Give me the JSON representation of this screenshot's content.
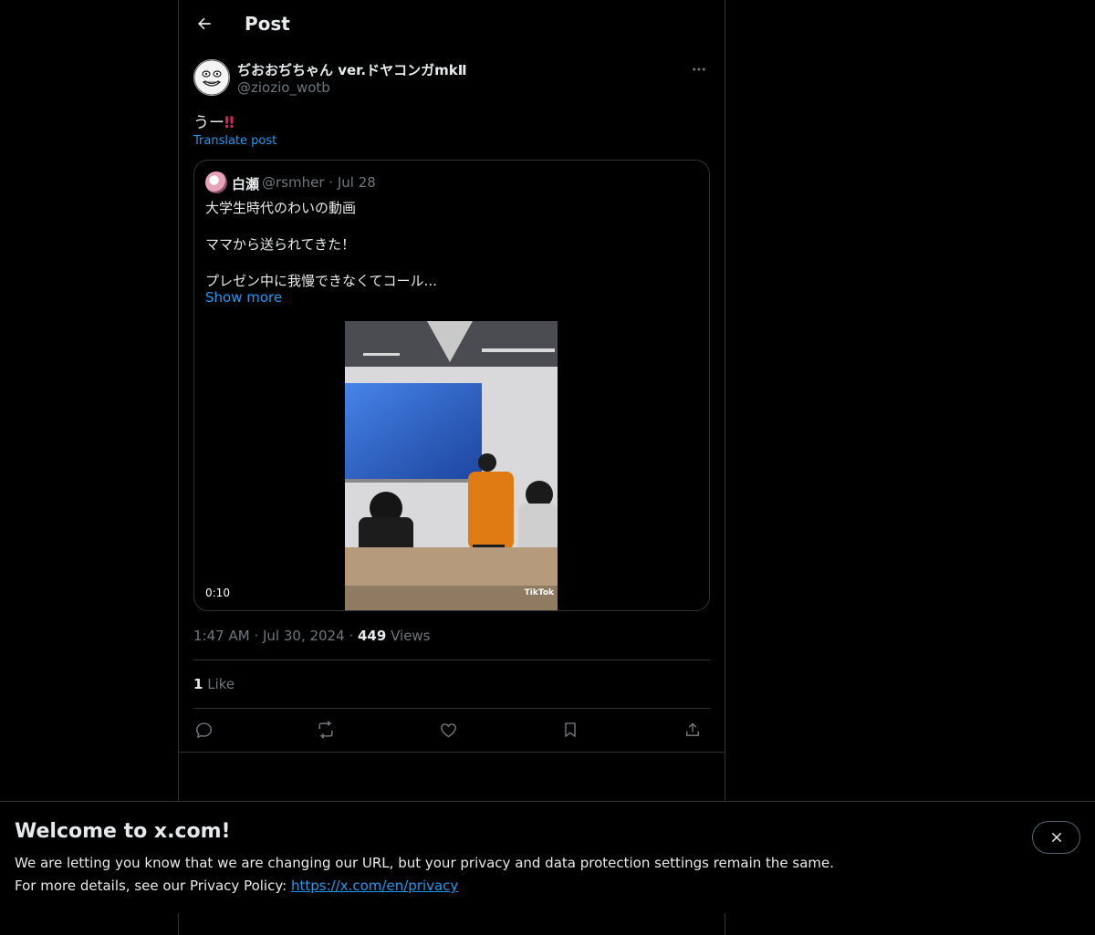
{
  "header": {
    "title": "Post"
  },
  "post": {
    "author_name": "ぢおおぢちゃん ver.ドヤコンガmkⅡ",
    "author_handle": "@ziozio_wotb",
    "text": "うー",
    "emoji": "‼",
    "translate_label": "Translate post",
    "timestamp": "1:47 AM",
    "date": "Jul 30, 2024",
    "views_count": "449",
    "views_label": "Views",
    "likes_count": "1",
    "likes_label": "Like"
  },
  "quote": {
    "name": "白瀬",
    "handle": "@rsmher",
    "date": "Jul 28",
    "lines": [
      "大学生時代のわいの動画",
      "ママから送られてきた！",
      "プレゼン中に我慢できなくてコール..."
    ],
    "show_more": "Show more",
    "video_duration": "0:10",
    "watermark": "TikTok"
  },
  "actions": [
    "reply-icon",
    "repost-icon",
    "like-icon",
    "bookmark-icon",
    "share-icon"
  ],
  "banner": {
    "title": "Welcome to x.com!",
    "line1": "We are letting you know that we are changing our URL, but your privacy and data protection settings remain the same.",
    "line2_prefix": "For more details, see our Privacy Policy:",
    "link": "https://x.com/en/privacy"
  },
  "colors": {
    "background": "#000000",
    "text": "#e7e9ea",
    "muted": "#71767b",
    "accent": "#1d9bf0",
    "border": "#2f3336"
  }
}
